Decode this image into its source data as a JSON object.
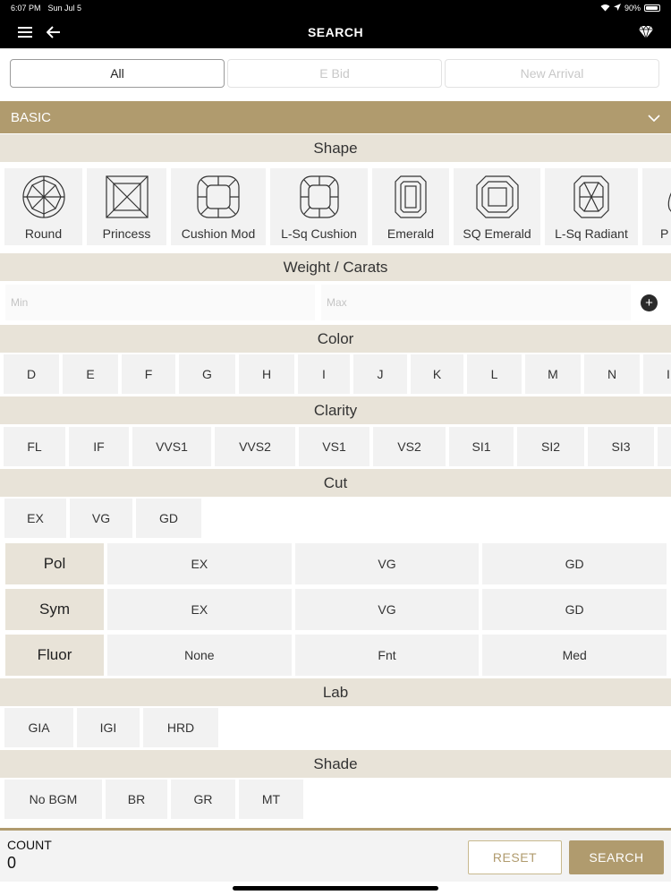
{
  "status": {
    "time": "6:07 PM",
    "date": "Sun Jul 5",
    "battery": "90%"
  },
  "nav": {
    "title": "SEARCH"
  },
  "tabs": [
    {
      "label": "All",
      "active": true
    },
    {
      "label": "E Bid",
      "active": false
    },
    {
      "label": "New Arrival",
      "active": false
    }
  ],
  "basic": {
    "label": "BASIC"
  },
  "sections": {
    "shape": "Shape",
    "weight": "Weight / Carats",
    "color": "Color",
    "clarity": "Clarity",
    "cut": "Cut",
    "lab": "Lab",
    "shade": "Shade"
  },
  "shapes": [
    "Round",
    "Princess",
    "Cushion Mod",
    "L-Sq Cushion",
    "Emerald",
    "SQ Emerald",
    "L-Sq Radiant",
    "P"
  ],
  "weight": {
    "min_placeholder": "Min",
    "max_placeholder": "Max"
  },
  "colors": [
    "D",
    "E",
    "F",
    "G",
    "H",
    "I",
    "J",
    "K",
    "L",
    "M",
    "N",
    "I"
  ],
  "clarity": [
    "FL",
    "IF",
    "VVS1",
    "VVS2",
    "VS1",
    "VS2",
    "SI1",
    "SI2",
    "SI3",
    ""
  ],
  "cut": [
    "EX",
    "VG",
    "GD"
  ],
  "grid": [
    {
      "label": "Pol",
      "options": [
        "EX",
        "VG",
        "GD"
      ]
    },
    {
      "label": "Sym",
      "options": [
        "EX",
        "VG",
        "GD"
      ]
    },
    {
      "label": "Fluor",
      "options": [
        "None",
        "Fnt",
        "Med"
      ]
    }
  ],
  "lab": [
    "GIA",
    "IGI",
    "HRD"
  ],
  "shade": [
    "No BGM",
    "BR",
    "GR",
    "MT"
  ],
  "footer": {
    "count_label": "COUNT",
    "count_value": "0",
    "reset_label": "RESET",
    "search_label": "SEARCH"
  },
  "colors_theme": {
    "accent": "#b09b6e",
    "section_bg": "#e8e3d8",
    "chip_bg": "#f2f2f2"
  }
}
